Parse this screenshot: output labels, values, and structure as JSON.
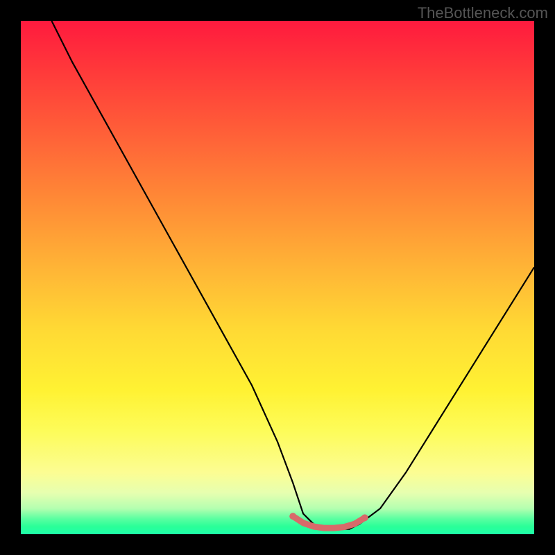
{
  "watermark": "TheBottleneck.com",
  "chart_data": {
    "type": "line",
    "title": "",
    "xlabel": "",
    "ylabel": "",
    "xlim": [
      0,
      100
    ],
    "ylim": [
      0,
      100
    ],
    "series": [
      {
        "name": "bottleneck-curve",
        "color": "#000000",
        "x": [
          6,
          10,
          15,
          20,
          25,
          30,
          35,
          40,
          45,
          50,
          53,
          55,
          57,
          59,
          62,
          64,
          66,
          70,
          75,
          80,
          85,
          90,
          95,
          100
        ],
        "y": [
          100,
          92,
          83,
          74,
          65,
          56,
          47,
          38,
          29,
          18,
          10,
          4,
          2,
          1,
          1,
          1,
          2,
          5,
          12,
          20,
          28,
          36,
          44,
          52
        ]
      },
      {
        "name": "minimum-highlight",
        "color": "#d86a6a",
        "x": [
          53,
          55,
          57,
          59,
          61,
          63,
          65,
          67
        ],
        "y": [
          3.5,
          2.2,
          1.5,
          1.2,
          1.2,
          1.4,
          2.0,
          3.2
        ]
      }
    ],
    "gradient": {
      "top_color": "#ff1a3e",
      "bottom_color": "#1effa8"
    }
  }
}
